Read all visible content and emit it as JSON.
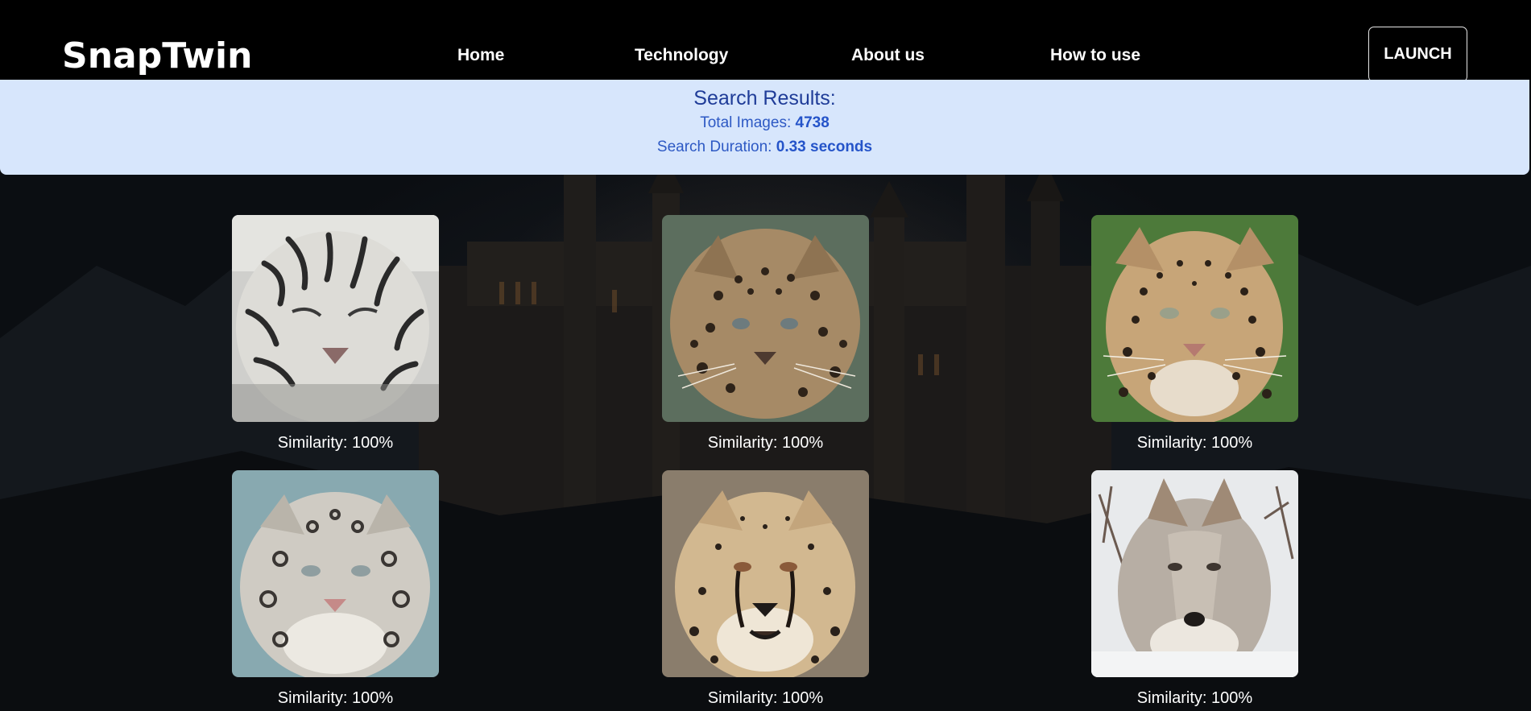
{
  "brand": {
    "logo": "SnapTwin"
  },
  "nav": {
    "links": [
      "Home",
      "Technology",
      "About us",
      "How to use"
    ],
    "launch_label": "LAUNCH"
  },
  "results": {
    "title": "Search Results:",
    "total_label": "Total Images: ",
    "total_value": "4738",
    "duration_label": "Search Duration: ",
    "duration_value": "0.33 seconds"
  },
  "grid": [
    {
      "animal": "white tiger",
      "caption": "Similarity: 100%"
    },
    {
      "animal": "leopard cub",
      "caption": "Similarity: 100%"
    },
    {
      "animal": "leopard",
      "caption": "Similarity: 100%"
    },
    {
      "animal": "snow leopard",
      "caption": "Similarity: 100%"
    },
    {
      "animal": "cheetah",
      "caption": "Similarity: 100%"
    },
    {
      "animal": "gray wolf",
      "caption": "Similarity: 100%"
    }
  ],
  "colors": {
    "navbar": "#000000",
    "results_panel": "#d7e6fc",
    "results_title": "#1f3c98",
    "results_text": "#2d59c4",
    "caption_text": "#ffffff"
  }
}
